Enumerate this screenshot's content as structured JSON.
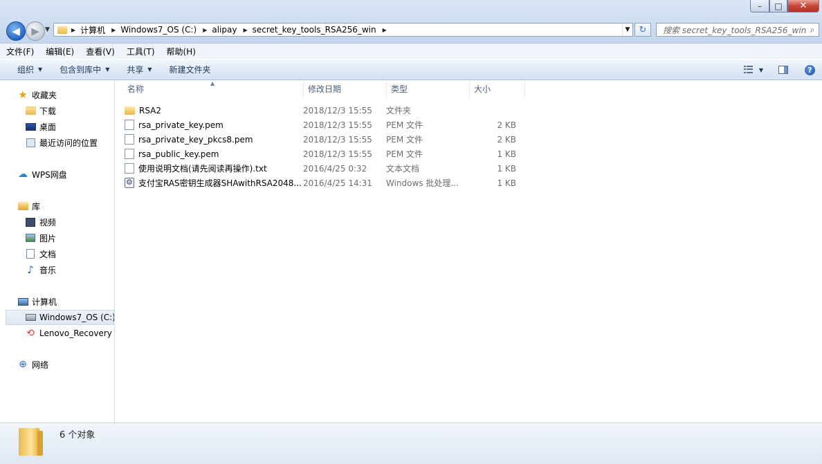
{
  "window": {
    "min_glyph": "–",
    "max_glyph": "□",
    "close_glyph": "✕"
  },
  "nav": {
    "back_glyph": "◀",
    "forward_glyph": "▶",
    "history_glyph": "▼"
  },
  "address": {
    "crumbs": [
      "计算机",
      "Windows7_OS (C:)",
      "alipay",
      "secret_key_tools_RSA256_win"
    ],
    "arrow_glyph": "▶",
    "drop_glyph": "▼",
    "refresh_glyph": "↻"
  },
  "search": {
    "placeholder": "搜索 secret_key_tools_RSA256_win",
    "icon_glyph": "⌕"
  },
  "menu": [
    "文件(F)",
    "编辑(E)",
    "查看(V)",
    "工具(T)",
    "帮助(H)"
  ],
  "toolbar": {
    "organize": "组织",
    "include_library": "包含到库中",
    "share": "共享",
    "new_folder": "新建文件夹",
    "caret": "▼",
    "help_glyph": "?"
  },
  "sidebar": {
    "favorites": "收藏夹",
    "downloads": "下载",
    "desktop": "桌面",
    "recent": "最近访问的位置",
    "wps": "WPS网盘",
    "libraries": "库",
    "videos": "视频",
    "pictures": "图片",
    "documents": "文档",
    "music": "音乐",
    "computer": "计算机",
    "c_drive": "Windows7_OS (C:)",
    "recovery": "Lenovo_Recovery (",
    "network": "网络"
  },
  "columns": {
    "name": "名称",
    "modified": "修改日期",
    "type": "类型",
    "size": "大小"
  },
  "files": [
    {
      "name": "RSA2",
      "date": "2018/12/3 15:55",
      "type": "文件夹",
      "size": ""
    },
    {
      "name": "rsa_private_key.pem",
      "date": "2018/12/3 15:55",
      "type": "PEM 文件",
      "size": "2 KB"
    },
    {
      "name": "rsa_private_key_pkcs8.pem",
      "date": "2018/12/3 15:55",
      "type": "PEM 文件",
      "size": "2 KB"
    },
    {
      "name": "rsa_public_key.pem",
      "date": "2018/12/3 15:55",
      "type": "PEM 文件",
      "size": "1 KB"
    },
    {
      "name": "使用说明文档(请先阅读再操作).txt",
      "date": "2016/4/25 0:32",
      "type": "文本文档",
      "size": "1 KB"
    },
    {
      "name": "支付宝RAS密钥生成器SHAwithRSA2048...",
      "date": "2016/4/25 14:31",
      "type": "Windows 批处理...",
      "size": "1 KB"
    }
  ],
  "status": {
    "count": "6 个对象"
  },
  "icons": {
    "star": "star-icon",
    "cloud": "cloud-icon",
    "music": "music-note-icon",
    "network": "network-icon"
  }
}
